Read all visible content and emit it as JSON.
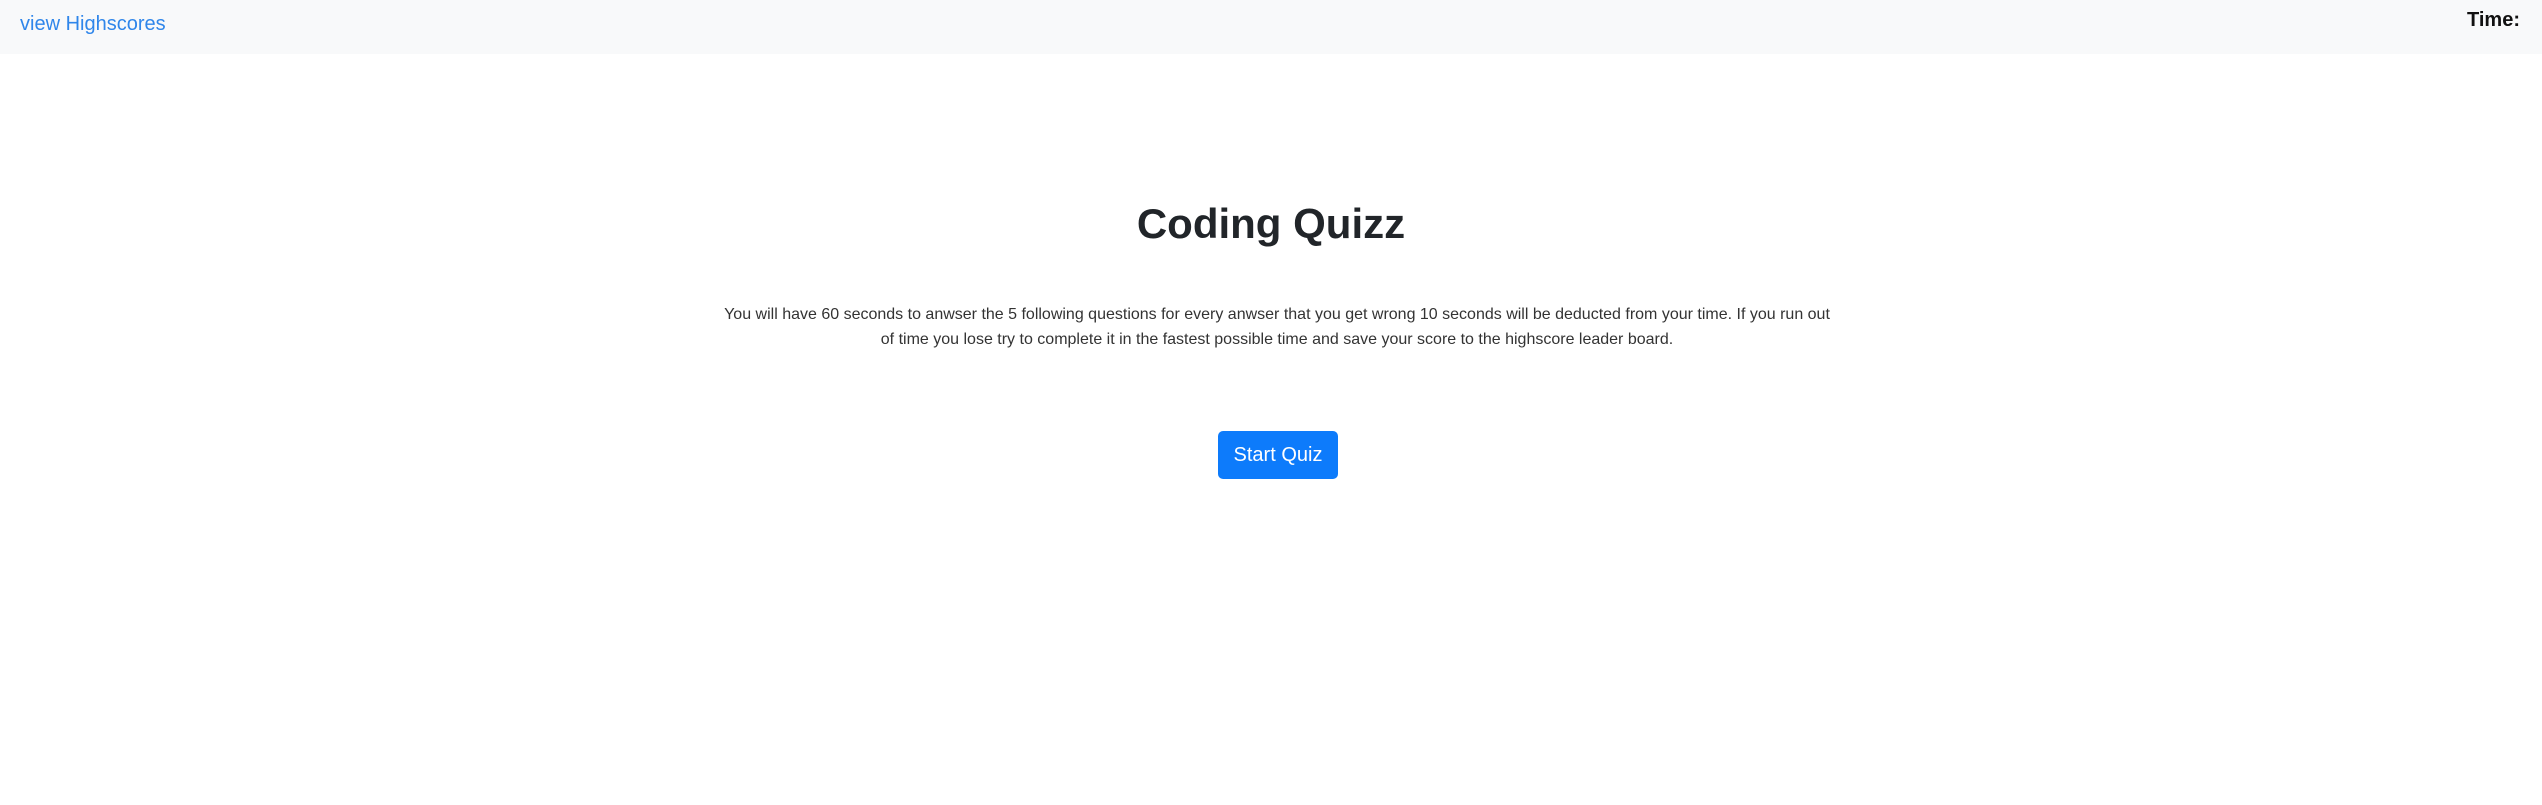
{
  "navbar": {
    "highscores_link": "view Highscores",
    "time_label": "Time:",
    "time_value": ""
  },
  "main": {
    "title": "Coding Quizz",
    "instructions": "You will have 60 seconds to anwser the 5 following questions for every anwser that you get wrong 10 seconds will be deducted from your time. If you run out of time you lose try to complete it in the fastest possible time and save your score to the highscore leader board.",
    "start_button": "Start Quiz"
  },
  "colors": {
    "navbar_bg": "#f8f9fa",
    "link": "#2f86ea",
    "primary_button": "#0d7bfb",
    "text": "#212529"
  }
}
